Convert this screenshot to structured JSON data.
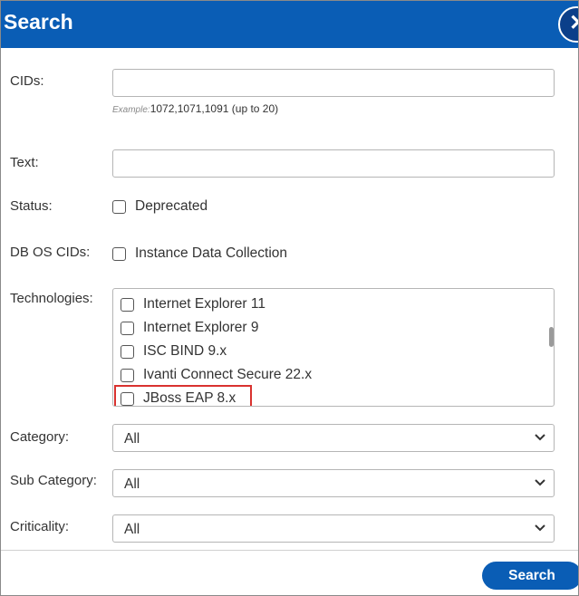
{
  "dialog": {
    "title": "Search",
    "close_glyph": "✕"
  },
  "colors": {
    "header_bg": "#0a5db5",
    "highlight_border": "#d9322f"
  },
  "fields": {
    "cids": {
      "label": "CIDs:",
      "value": "",
      "hint_example": "Example:",
      "hint_text": "1072,1071,1091 (up to 20)"
    },
    "text": {
      "label": "Text:",
      "value": ""
    },
    "status": {
      "label": "Status:",
      "option": "Deprecated",
      "checked": false
    },
    "db_os_cids": {
      "label": "DB OS CIDs:",
      "option": "Instance Data Collection",
      "checked": false
    },
    "technologies": {
      "label": "Technologies:",
      "items": [
        "Internet Explorer 11",
        "Internet Explorer 9",
        "ISC BIND 9.x",
        "Ivanti Connect Secure 22.x",
        "JBoss EAP 8.x"
      ],
      "highlighted_item": "JBoss EAP 8.x"
    },
    "category": {
      "label": "Category:",
      "selected": "All"
    },
    "sub_category": {
      "label": "Sub Category:",
      "selected": "All"
    },
    "criticality": {
      "label": "Criticality:",
      "selected": "All"
    }
  },
  "actions": {
    "search_label": "Search"
  },
  "icons": {
    "chevron": "chevron-down-icon",
    "close": "close-icon"
  }
}
